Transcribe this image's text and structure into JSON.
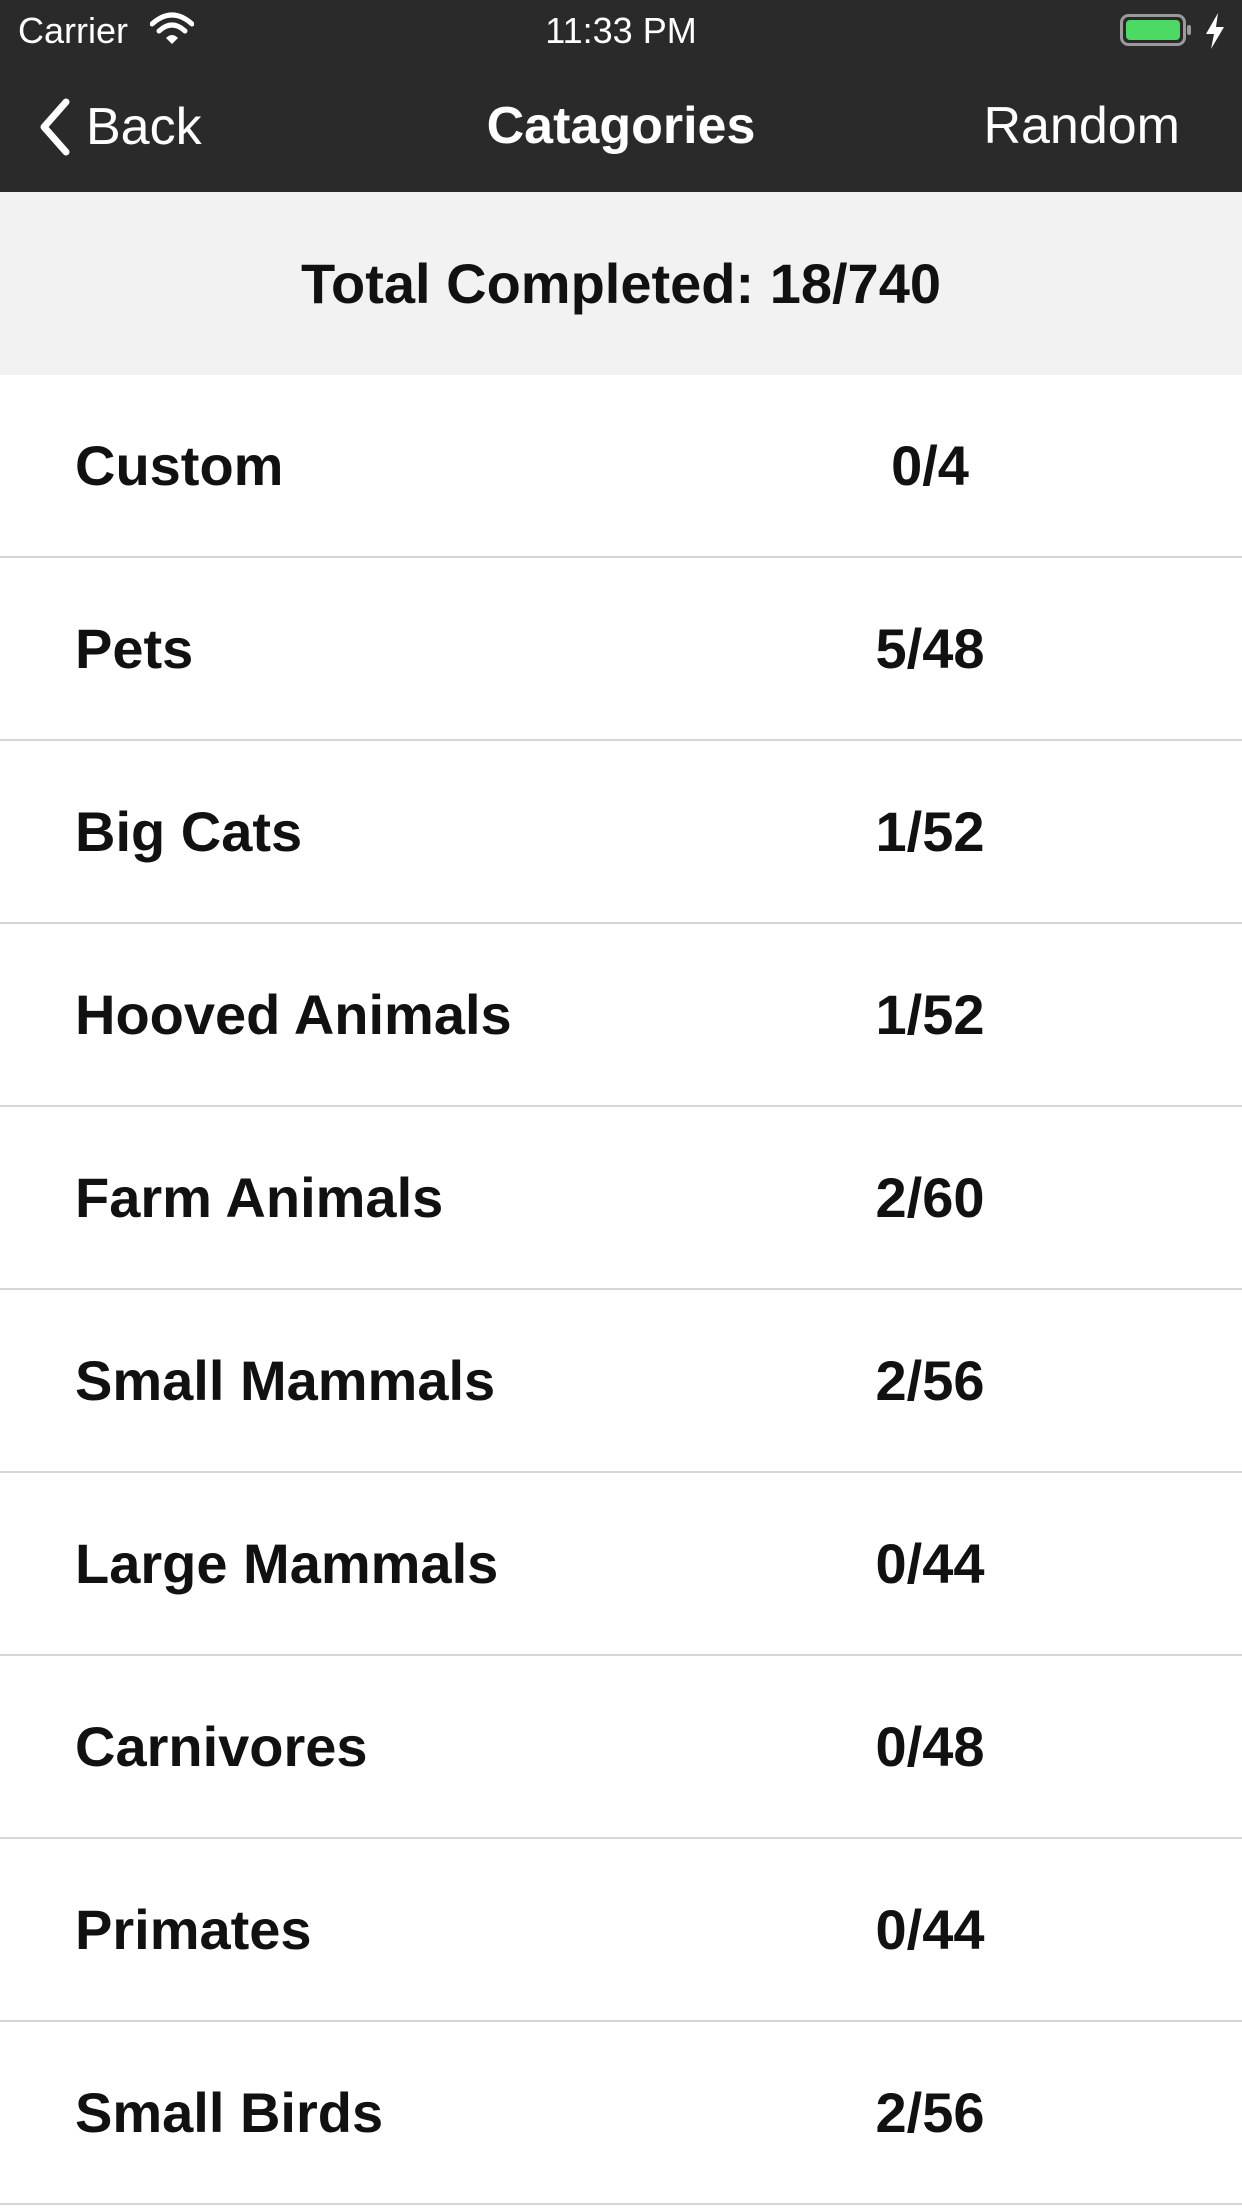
{
  "status_bar": {
    "carrier": "Carrier",
    "time": "11:33 PM",
    "battery_color": "#4cd964"
  },
  "nav": {
    "back_label": "Back",
    "title": "Catagories",
    "random_label": "Random"
  },
  "summary": {
    "text": "Total Completed: 18/740"
  },
  "categories": [
    {
      "name": "Custom",
      "count": "0/4"
    },
    {
      "name": "Pets",
      "count": "5/48"
    },
    {
      "name": "Big Cats",
      "count": "1/52"
    },
    {
      "name": "Hooved Animals",
      "count": "1/52"
    },
    {
      "name": "Farm Animals",
      "count": "2/60"
    },
    {
      "name": "Small Mammals",
      "count": "2/56"
    },
    {
      "name": "Large Mammals",
      "count": "0/44"
    },
    {
      "name": "Carnivores",
      "count": "0/48"
    },
    {
      "name": "Primates",
      "count": "0/44"
    },
    {
      "name": "Small Birds",
      "count": "2/56"
    }
  ]
}
